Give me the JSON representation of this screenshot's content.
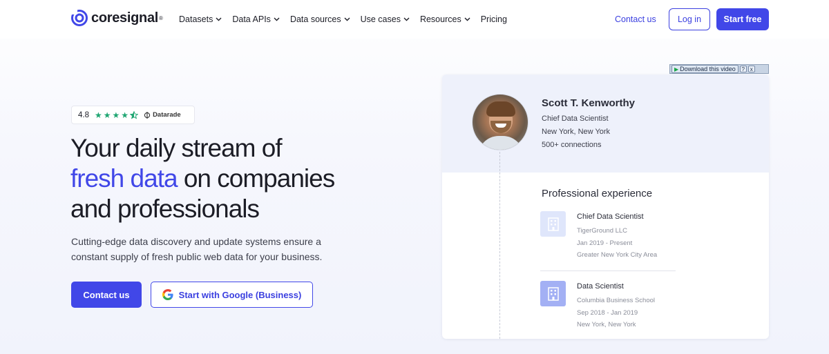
{
  "header": {
    "logo_text": "coresignal",
    "logo_mark": "®",
    "nav": [
      {
        "label": "Datasets",
        "dropdown": true
      },
      {
        "label": "Data APIs",
        "dropdown": true
      },
      {
        "label": "Data sources",
        "dropdown": true
      },
      {
        "label": "Use cases",
        "dropdown": true
      },
      {
        "label": "Resources",
        "dropdown": true
      },
      {
        "label": "Pricing",
        "dropdown": false
      }
    ],
    "contact_link": "Contact us",
    "login": "Log in",
    "start_free": "Start free"
  },
  "hero": {
    "rating": {
      "score": "4.8",
      "stars": 4.5,
      "provider": "Datarade"
    },
    "title_line1": "Your daily stream of",
    "title_accent": "fresh data",
    "title_line2_rest": " on companies",
    "title_line3": "and professionals",
    "subtitle": "Cutting-edge data discovery and update systems ensure a constant supply of fresh public web data for your business.",
    "cta_primary": "Contact us",
    "cta_google": "Start with Google (Business)"
  },
  "video_bar": {
    "download_label": "Download this video",
    "help": "?",
    "close": "x"
  },
  "profile": {
    "name": "Scott T. Kenworthy",
    "title": "Chief Data Scientist",
    "location": "New York, New York",
    "connections": "500+ connections",
    "experience_heading": "Professional experience",
    "experience": [
      {
        "role": "Chief Data Scientist",
        "company": "TigerGround LLC",
        "dates": "Jan 2019 - Present",
        "location": "Greater New York City Area"
      },
      {
        "role": "Data Scientist",
        "company": "Columbia Business School",
        "dates": "Sep 2018 - Jan 2019",
        "location": "New York, New York"
      }
    ]
  },
  "colors": {
    "accent": "#4147e8",
    "star": "#1fa672"
  }
}
